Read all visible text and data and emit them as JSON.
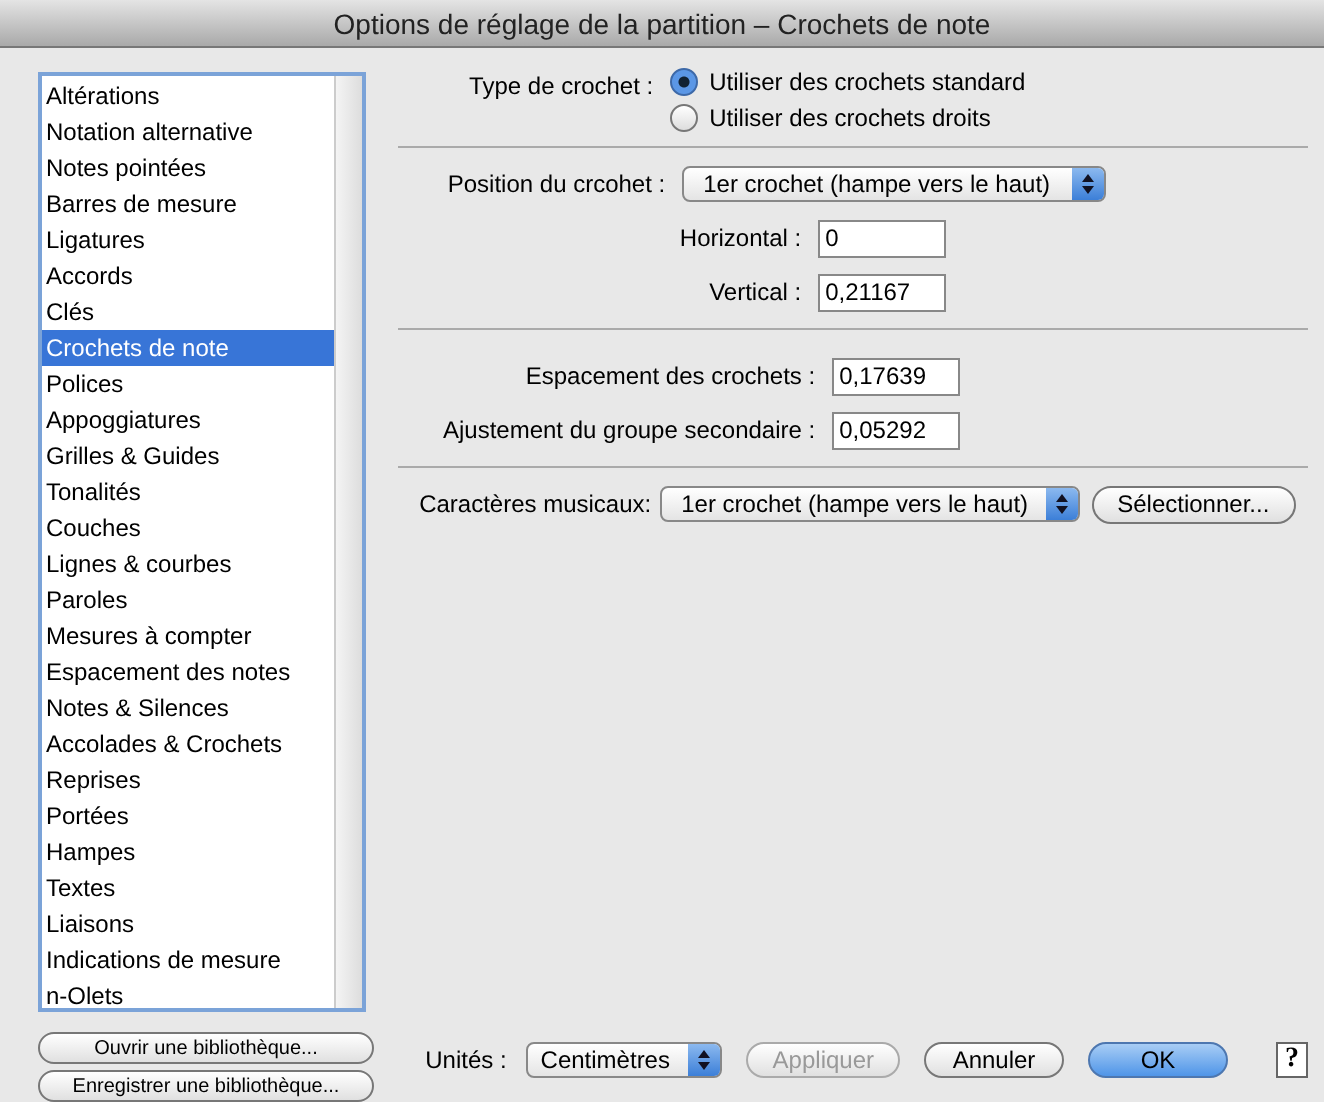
{
  "window": {
    "title": "Options de réglage de la partition – Crochets de note"
  },
  "sidebar": {
    "items": [
      {
        "label": "Altérations",
        "selected": false
      },
      {
        "label": "Notation alternative",
        "selected": false
      },
      {
        "label": "Notes pointées",
        "selected": false
      },
      {
        "label": "Barres de mesure",
        "selected": false
      },
      {
        "label": "Ligatures",
        "selected": false
      },
      {
        "label": "Accords",
        "selected": false
      },
      {
        "label": "Clés",
        "selected": false
      },
      {
        "label": "Crochets de note",
        "selected": true
      },
      {
        "label": "Polices",
        "selected": false
      },
      {
        "label": "Appoggiatures",
        "selected": false
      },
      {
        "label": "Grilles & Guides",
        "selected": false
      },
      {
        "label": "Tonalités",
        "selected": false
      },
      {
        "label": "Couches",
        "selected": false
      },
      {
        "label": "Lignes & courbes",
        "selected": false
      },
      {
        "label": "Paroles",
        "selected": false
      },
      {
        "label": "Mesures à compter",
        "selected": false
      },
      {
        "label": "Espacement des notes",
        "selected": false
      },
      {
        "label": "Notes & Silences",
        "selected": false
      },
      {
        "label": "Accolades & Crochets",
        "selected": false
      },
      {
        "label": "Reprises",
        "selected": false
      },
      {
        "label": "Portées",
        "selected": false
      },
      {
        "label": "Hampes",
        "selected": false
      },
      {
        "label": "Textes",
        "selected": false
      },
      {
        "label": "Liaisons",
        "selected": false
      },
      {
        "label": "Indications de mesure",
        "selected": false
      },
      {
        "label": "n-Olets",
        "selected": false
      }
    ],
    "library_buttons": [
      "Ouvrir une bibliothèque...",
      "Enregistrer une bibliothèque..."
    ]
  },
  "flag_type": {
    "label": "Type de crochet :",
    "options": [
      {
        "label": "Utiliser des crochets standard",
        "selected": true
      },
      {
        "label": "Utiliser des crochets droits",
        "selected": false
      }
    ]
  },
  "position": {
    "label": "Position du crcohet :",
    "value": "1er crochet (hampe vers le haut)",
    "fields": [
      {
        "label": "Horizontal :",
        "value": "0"
      },
      {
        "label": "Vertical :",
        "value": "0,21167"
      }
    ]
  },
  "spacing": {
    "fields": [
      {
        "label": "Espacement des crochets :",
        "value": "0,17639"
      },
      {
        "label": "Ajustement du groupe secondaire :",
        "value": "0,05292"
      }
    ]
  },
  "characters": {
    "label": "Caractères musicaux:",
    "value": "1er crochet (hampe vers le haut)",
    "button": "Sélectionner..."
  },
  "footer": {
    "units_label": "Unités :",
    "units_value": "Centimètres",
    "buttons": [
      {
        "label": "Appliquer",
        "kind": "disabled"
      },
      {
        "label": "Annuler",
        "kind": "normal"
      },
      {
        "label": "OK",
        "kind": "default"
      }
    ],
    "help": "?"
  }
}
